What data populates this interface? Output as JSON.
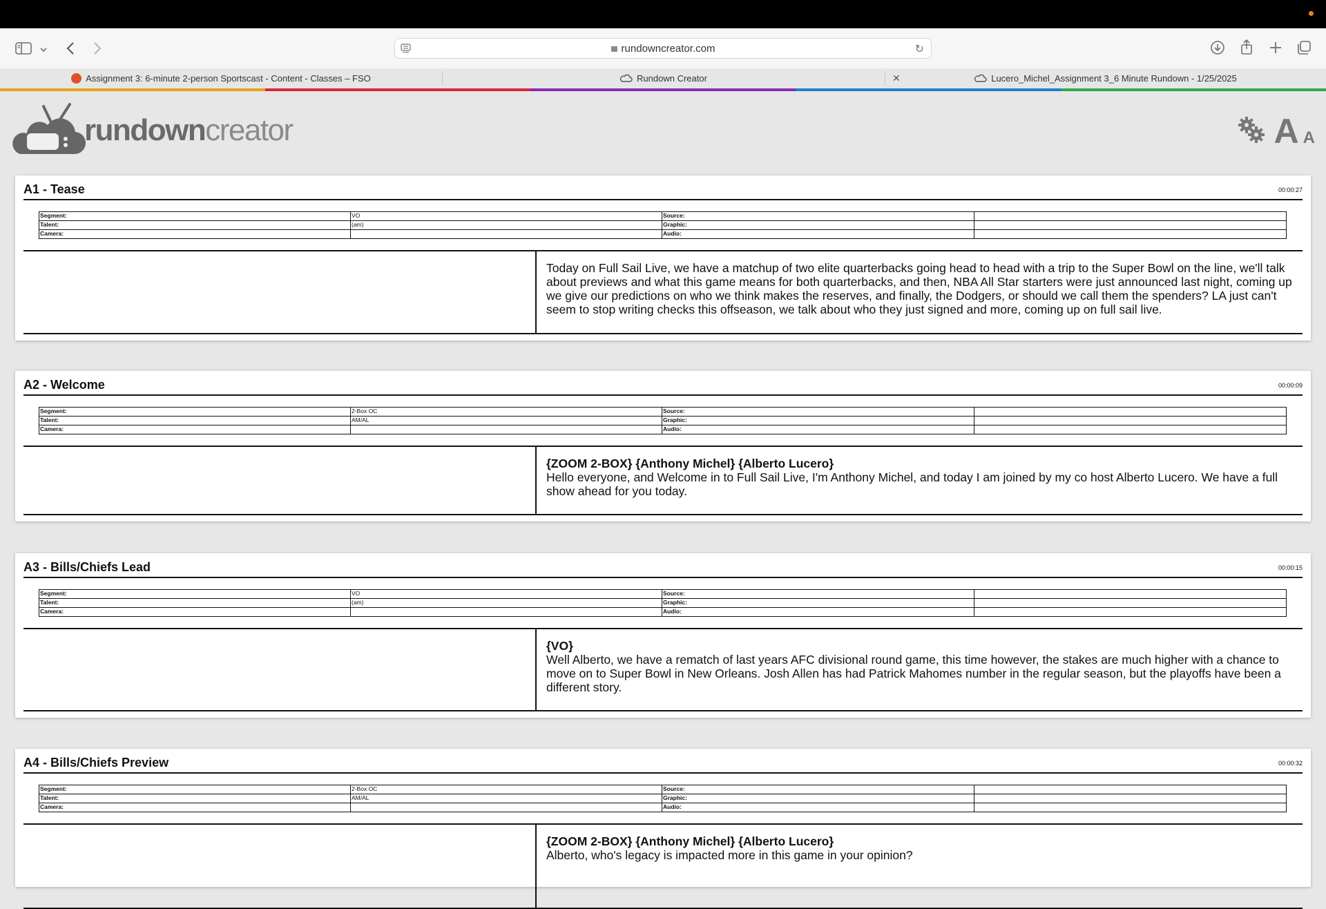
{
  "browser": {
    "url": "rundowncreator.com",
    "tabs": [
      {
        "label": "Assignment 3: 6-minute 2-person Sportscast - Content - Classes – FSO"
      },
      {
        "label": "Rundown Creator"
      },
      {
        "label": "Lucero_Michel_Assignment 3_6 Minute Rundown - 1/25/2025"
      }
    ],
    "tab_colors": [
      "#e8a21a",
      "#d8263a",
      "#8a2bb0",
      "#1f7fd1",
      "#2fa84f"
    ]
  },
  "app": {
    "logo_bold": "rundown",
    "logo_light": "creator",
    "font_big": "A",
    "font_small": "A"
  },
  "labels": {
    "segment": "Segment:",
    "talent": "Talent:",
    "camera": "Camera:",
    "source": "Source:",
    "graphic": "Graphic:",
    "audio": "Audio:"
  },
  "stories": [
    {
      "title": "A1 - Tease",
      "time": "00:00:27",
      "segment": "VO",
      "talent": "(am)",
      "camera": "",
      "source": "",
      "graphic": "",
      "audio": "",
      "cue": "",
      "text": "Today on Full Sail Live, we have a matchup of two elite quarterbacks going head to head with a trip to the Super Bowl on the line, we'll talk about previews and what this game means for both quarterbacks, and then, NBA All Star starters were just announced last night, coming up we give our predictions on who we think makes the reserves, and finally, the Dodgers, or should we call them the spenders? LA just can't seem to stop writing checks this offseason, we talk about who they just signed and more, coming up on full sail live."
    },
    {
      "title": "A2 - Welcome",
      "time": "00:00:09",
      "segment": "2-Box OC",
      "talent": "AM/AL",
      "camera": "",
      "source": "",
      "graphic": "",
      "audio": "",
      "cue": "{ZOOM 2-BOX} {Anthony Michel} {Alberto Lucero}",
      "text": "Hello everyone, and Welcome in to Full Sail Live, I'm Anthony Michel, and today I am joined by my co host Alberto Lucero. We have a full show ahead for you today."
    },
    {
      "title": "A3 - Bills/Chiefs Lead",
      "time": "00:00:15",
      "segment": "VO",
      "talent": "(am)",
      "camera": "",
      "source": "",
      "graphic": "",
      "audio": "",
      "cue": "{VO}",
      "text": "Well Alberto, we have a rematch of last years AFC divisional round game, this time however, the stakes are much higher with a chance to move on to Super Bowl in New Orleans. Josh Allen has had Patrick Mahomes number in the regular season, but the playoffs have been a different story."
    },
    {
      "title": "A4 - Bills/Chiefs Preview",
      "time": "00:00:32",
      "segment": "2-Box OC",
      "talent": "AM/AL",
      "camera": "",
      "source": "",
      "graphic": "",
      "audio": "",
      "cue": "{ZOOM 2-BOX} {Anthony Michel} {Alberto Lucero}",
      "text": "Alberto, who's legacy is impacted more in this game in your opinion?"
    }
  ]
}
